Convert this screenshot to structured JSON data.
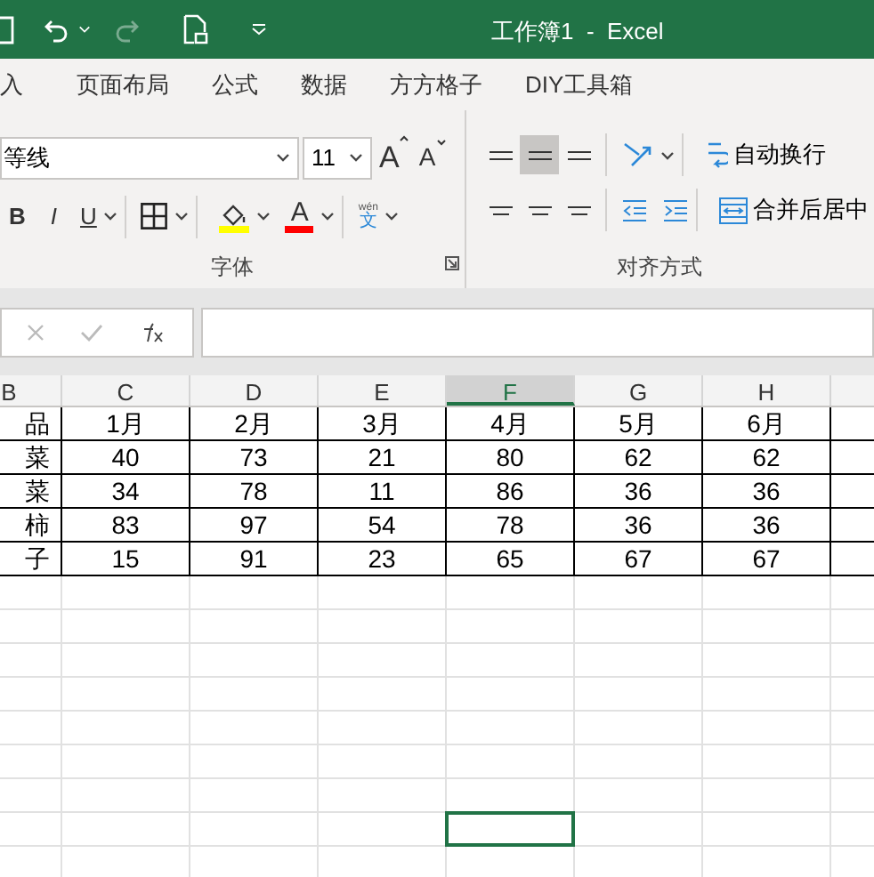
{
  "window": {
    "title": "工作簿1  -  Excel"
  },
  "ribbon_tabs": [
    {
      "label": "入",
      "selected": false
    },
    {
      "label": "页面布局",
      "selected": false
    },
    {
      "label": "公式",
      "selected": false
    },
    {
      "label": "数据",
      "selected": false
    },
    {
      "label": "方方格子",
      "selected": false
    },
    {
      "label": "DIY工具箱",
      "selected": false
    }
  ],
  "font_group": {
    "font_name": "等线",
    "font_size": "11",
    "grow_glyph": "A",
    "shrink_glyph": "A",
    "bold_glyph": "B",
    "italic_glyph": "I",
    "underline_glyph": "U",
    "font_color_glyph": "A",
    "phonetic_top": "wén",
    "phonetic_bottom": "文",
    "label": "字体"
  },
  "alignment_group": {
    "middle_align_selected": true,
    "wrap_text": "自动换行",
    "merge_center": "合并后居中",
    "label": "对齐方式"
  },
  "columns": [
    {
      "label": "B",
      "selected": false
    },
    {
      "label": "C",
      "selected": false
    },
    {
      "label": "D",
      "selected": false
    },
    {
      "label": "E",
      "selected": false
    },
    {
      "label": "F",
      "selected": true
    },
    {
      "label": "G",
      "selected": false
    },
    {
      "label": "H",
      "selected": false
    }
  ],
  "rows": [
    [
      "品",
      "1月",
      "2月",
      "3月",
      "4月",
      "5月",
      "6月"
    ],
    [
      "菜",
      "40",
      "73",
      "21",
      "80",
      "62",
      "62"
    ],
    [
      "菜",
      "34",
      "78",
      "11",
      "86",
      "36",
      "36"
    ],
    [
      "柿",
      "83",
      "97",
      "54",
      "78",
      "36",
      "36"
    ],
    [
      "子",
      "15",
      "91",
      "23",
      "65",
      "67",
      "67"
    ]
  ]
}
